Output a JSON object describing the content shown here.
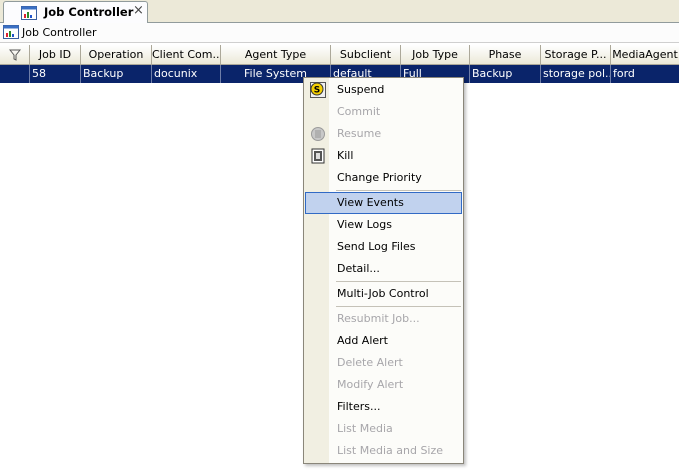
{
  "tab": {
    "title": "Job Controller",
    "close_glyph": "×"
  },
  "window": {
    "title": "Job Controller"
  },
  "grid": {
    "columns": [
      "Job ID",
      "Operation",
      "Client Com...",
      "Agent Type",
      "Subclient",
      "Job Type",
      "Phase",
      "Storage P...",
      "MediaAgent"
    ],
    "selected_row": [
      "58",
      "Backup",
      "docunix",
      "File System",
      "default",
      "Full",
      "Backup",
      "storage pol...",
      "ford"
    ]
  },
  "context_menu": {
    "items": [
      {
        "label": "Suspend",
        "enabled": true,
        "icon": "suspend-icon"
      },
      {
        "label": "Commit",
        "enabled": false
      },
      {
        "label": "Resume",
        "enabled": false,
        "icon": "resume-icon"
      },
      {
        "label": "Kill",
        "enabled": true,
        "icon": "kill-icon"
      },
      {
        "label": "Change Priority",
        "enabled": true
      },
      {
        "label": "View Events",
        "enabled": true,
        "highlighted": true
      },
      {
        "label": "View Logs",
        "enabled": true
      },
      {
        "label": "Send Log Files",
        "enabled": true
      },
      {
        "label": "Detail...",
        "enabled": true
      },
      {
        "label": "Multi-Job Control",
        "enabled": true
      },
      {
        "label": "Resubmit Job...",
        "enabled": false
      },
      {
        "label": "Add Alert",
        "enabled": true
      },
      {
        "label": "Delete Alert",
        "enabled": false
      },
      {
        "label": "Modify Alert",
        "enabled": false
      },
      {
        "label": "Filters...",
        "enabled": true
      },
      {
        "label": "List Media",
        "enabled": false
      },
      {
        "label": "List Media and Size",
        "enabled": false
      }
    ]
  },
  "colors": {
    "selection": "#0a246a",
    "menu_highlight": "#c1d2ee",
    "menu_highlight_border": "#316ac5",
    "disabled_text": "#a7a6aa"
  }
}
